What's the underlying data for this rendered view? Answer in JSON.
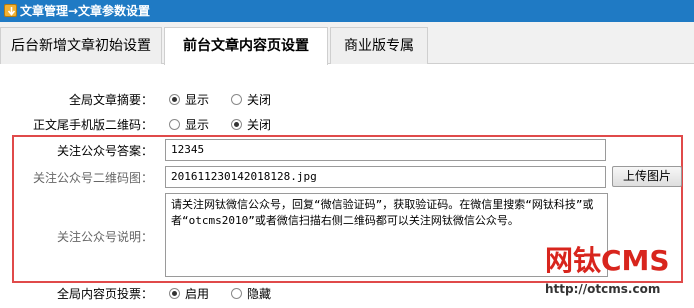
{
  "titlebar": {
    "title": "文章管理→文章参数设置",
    "icon": "arrow-down-icon"
  },
  "tabs": [
    {
      "label": "后台新增文章初始设置",
      "active": false
    },
    {
      "label": "前台文章内容页设置",
      "active": true
    },
    {
      "label": "商业版专属",
      "active": false
    }
  ],
  "fields": {
    "summary": {
      "label": "全局文章摘要：",
      "options": [
        "显示",
        "关闭"
      ],
      "selected": "显示"
    },
    "qrcode": {
      "label": "正文尾手机版二维码：",
      "options": [
        "显示",
        "关闭"
      ],
      "selected": "关闭"
    },
    "answer": {
      "label": "关注公众号答案：",
      "value": "12345"
    },
    "qrimage": {
      "label": "关注公众号二维码图：",
      "value": "201611230142018128.jpg",
      "button": "上传图片"
    },
    "desc": {
      "label": "关注公众号说明：",
      "value": "请关注网钛微信公众号，回复“微信验证码”，获取验证码。在微信里搜索“网钛科技”或者“otcms2010”或者微信扫描右侧二维码都可以关注网钛微信公众号。"
    },
    "vote": {
      "label": "全局内容页投票：",
      "options": [
        "启用",
        "隐藏"
      ],
      "selected": "启用"
    }
  },
  "watermark": {
    "logo": "网钛CMS",
    "url": "http://otcms.com"
  },
  "colors": {
    "titlebar": "#1f7ac4",
    "highlight_border": "#e04a4a",
    "logo": "#d8251d"
  }
}
